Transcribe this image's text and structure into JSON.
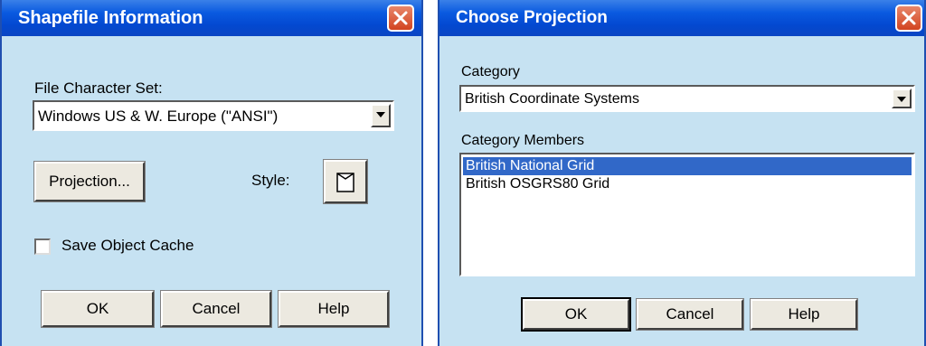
{
  "shapefile_dialog": {
    "title": "Shapefile Information",
    "charset_label": "File Character Set:",
    "charset_value": "Windows US & W. Europe (\"ANSI\")",
    "projection_button": "Projection...",
    "style_label": "Style:",
    "save_cache_label": "Save Object Cache",
    "save_cache_checked": false,
    "ok_button": "OK",
    "cancel_button": "Cancel",
    "help_button": "Help"
  },
  "projection_dialog": {
    "title": "Choose Projection",
    "category_label": "Category",
    "category_value": "British Coordinate Systems",
    "members_label": "Category Members",
    "members": [
      {
        "label": "British National Grid",
        "selected": true
      },
      {
        "label": "British OSGRS80 Grid",
        "selected": false
      }
    ],
    "ok_button": "OK",
    "cancel_button": "Cancel",
    "help_button": "Help"
  },
  "colors": {
    "dialog_bg": "#c6e2f2",
    "titlebar": "#0a5ae0",
    "selection": "#3168c8",
    "close": "#d24420"
  },
  "icons": [
    "close-icon",
    "dropdown-arrow-icon",
    "style-swatch-icon"
  ]
}
